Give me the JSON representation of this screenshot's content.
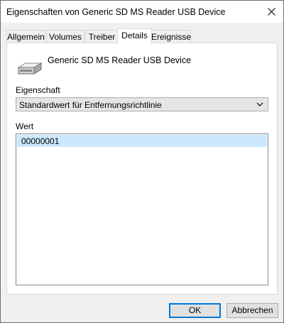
{
  "window": {
    "title": "Eigenschaften von Generic SD MS Reader USB Device"
  },
  "tabs": [
    {
      "label": "Allgemein",
      "active": false
    },
    {
      "label": "Volumes",
      "active": false
    },
    {
      "label": "Treiber",
      "active": false
    },
    {
      "label": "Details",
      "active": true
    },
    {
      "label": "Ereignisse",
      "active": false
    }
  ],
  "details": {
    "device_name": "Generic SD MS Reader USB Device",
    "device_icon": "drive-icon",
    "property_label": "Eigenschaft",
    "property_selected": "Standardwert für Entfernungsrichtlinie",
    "value_label": "Wert",
    "values": [
      "00000001"
    ]
  },
  "buttons": {
    "ok": "OK",
    "cancel": "Abbrechen"
  },
  "colors": {
    "selection": "#cce8ff",
    "default_button_border": "#0078d7"
  }
}
